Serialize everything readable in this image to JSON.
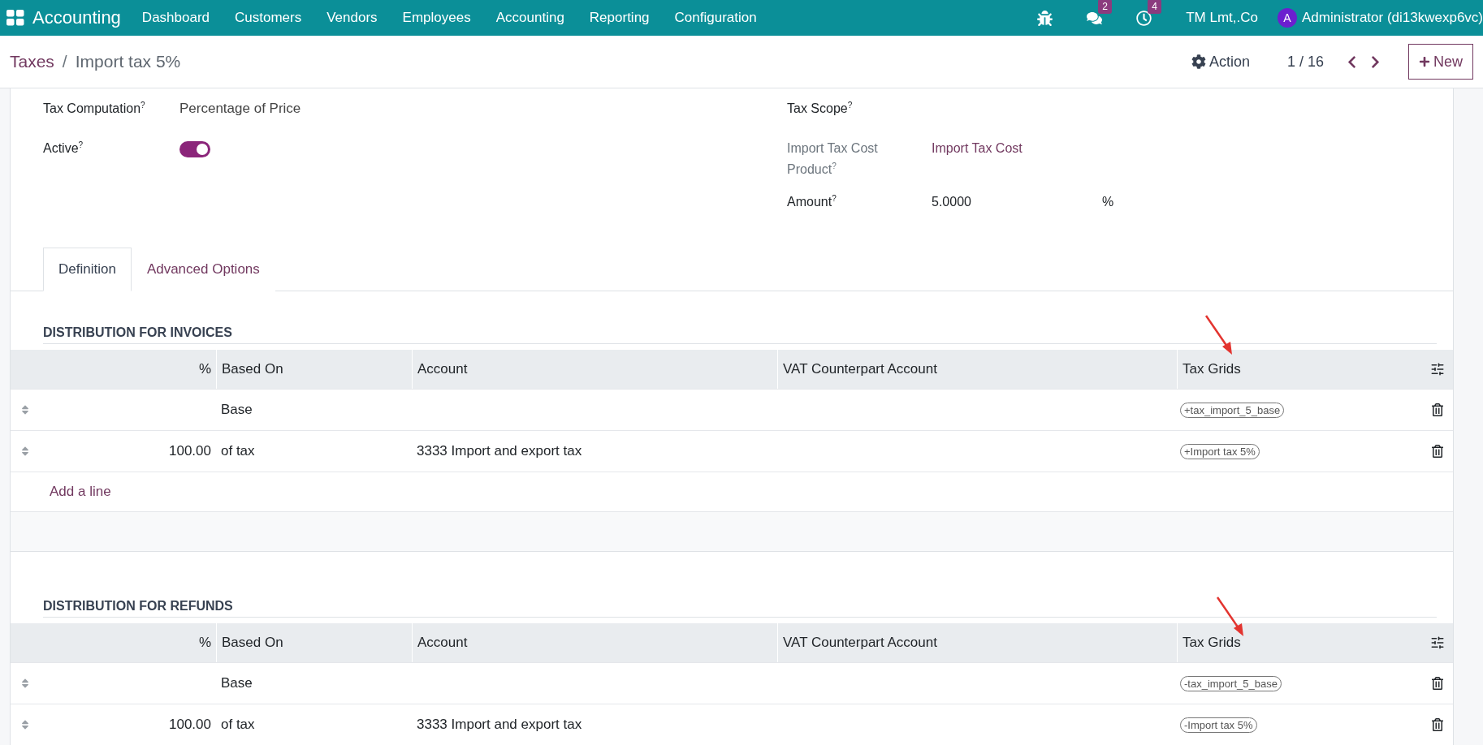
{
  "navbar": {
    "app": "Accounting",
    "menu": [
      "Dashboard",
      "Customers",
      "Vendors",
      "Employees",
      "Accounting",
      "Reporting",
      "Configuration"
    ],
    "systray": [
      {
        "kind": "bug"
      },
      {
        "kind": "chat",
        "badge": "2"
      },
      {
        "kind": "clock",
        "badge": "4"
      }
    ],
    "company": "TM Lmt,.Co",
    "user": {
      "initial": "A",
      "name": "Administrator (di13kwexp6vc)"
    }
  },
  "breadcrumb": {
    "parent": "Taxes",
    "separator": "/",
    "current": "Import tax 5%"
  },
  "control": {
    "action": "Action",
    "pager": "1 / 16",
    "new": "New"
  },
  "fields_left": [
    {
      "kind": "text",
      "label": "Tax Computation$^{?}$",
      "value": "Percentage of Price"
    },
    {
      "kind": "toggle",
      "label": "Active$^{?}$",
      "on": true
    }
  ],
  "fields_right": [
    {
      "kind": "empty",
      "label": "Tax Scope$^{?}$",
      "muted": false
    },
    {
      "kind": "link",
      "label": "Import Tax Cost Product$^{?}$",
      "value": "Import Tax Cost",
      "muted": true
    },
    {
      "kind": "amount",
      "label": "Amount$^{?}$",
      "value": "5.0000",
      "unit": "%",
      "muted": false
    }
  ],
  "tabs": [
    {
      "label": "Definition",
      "selected": true
    },
    {
      "label": "Advanced Options",
      "selected": false
    }
  ],
  "sections": [
    {
      "title": "DISTRIBUTION FOR INVOICES",
      "columns": [
        "%",
        "Based On",
        "Account",
        "VAT Counterpart Account",
        "Tax Grids"
      ],
      "rows": [
        {
          "percent": "",
          "based_on": "Base",
          "account": "",
          "vat_account": "",
          "tax_grid": "+tax_import_5_base"
        },
        {
          "percent": "100.00",
          "based_on": "of tax",
          "account": "3333 Import and export tax",
          "vat_account": "",
          "tax_grid": "+Import tax 5%"
        }
      ],
      "add_line": "Add a line"
    },
    {
      "title": "DISTRIBUTION FOR REFUNDS",
      "columns": [
        "%",
        "Based On",
        "Account",
        "VAT Counterpart Account",
        "Tax Grids"
      ],
      "rows": [
        {
          "percent": "",
          "based_on": "Base",
          "account": "",
          "vat_account": "",
          "tax_grid": "-tax_import_5_base"
        },
        {
          "percent": "100.00",
          "based_on": "of tax",
          "account": "3333 Import and export tax",
          "vat_account": "",
          "tax_grid": "-Import tax 5%"
        }
      ]
    }
  ]
}
